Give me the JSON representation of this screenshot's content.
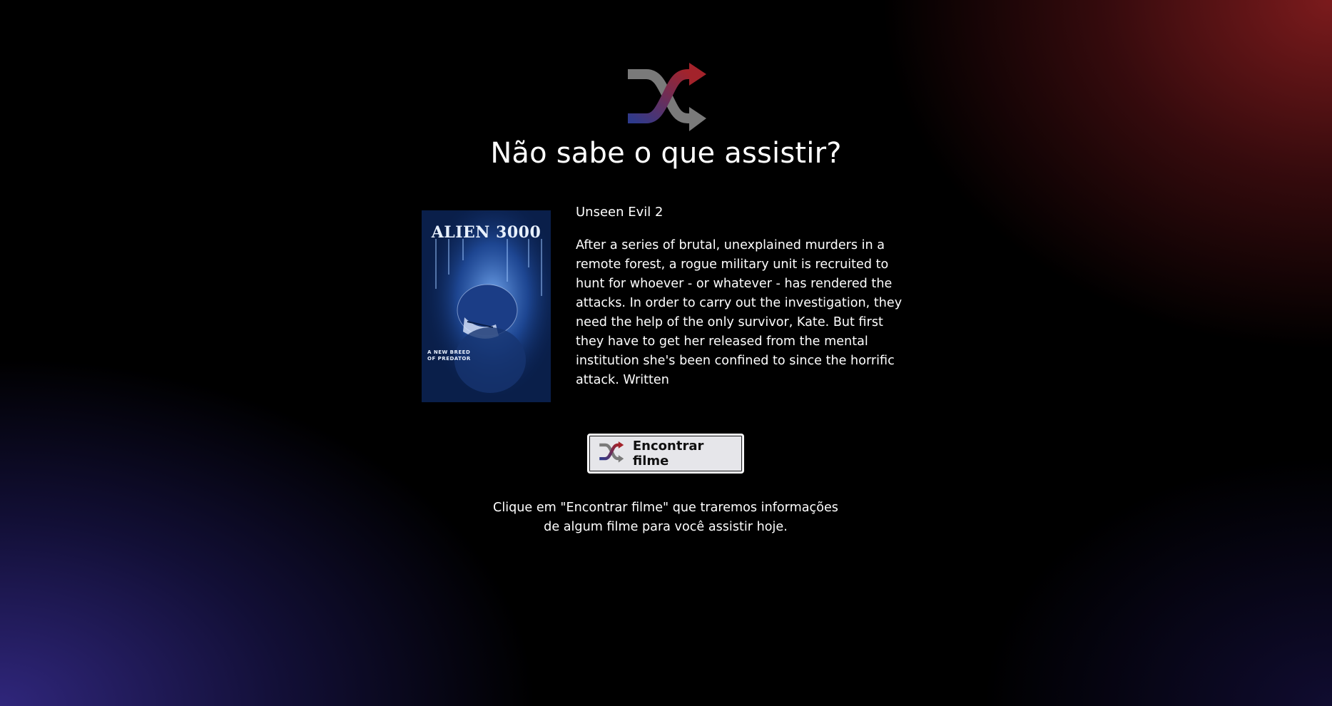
{
  "header": {
    "title": "Não sabe o que assistir?",
    "logo_icon": "shuffle-icon"
  },
  "movie": {
    "poster_title": "ALIEN 3000",
    "poster_tagline_line1": "A NEW BREED",
    "poster_tagline_line2": "OF PREDATOR",
    "title": "Unseen Evil 2",
    "overview": "After a series of brutal, unexplained murders in a remote forest, a rogue military unit is recruited to hunt for whoever - or whatever - has rendered the attacks. In order to carry out the investigation, they need the help of the only survivor, Kate. But first they have to get her released from the mental institution she's been confined to since the horrific attack. Written"
  },
  "action": {
    "button_label": "Encontrar filme",
    "button_icon": "shuffle-icon"
  },
  "hint": {
    "text": "Clique em \"Encontrar filme\" que traremos informações de algum filme para você assistir hoje."
  },
  "colors": {
    "accent_red": "#a3232b",
    "accent_blue": "#2e3a8c",
    "arrow_gray": "#7a7a7a",
    "button_bg": "#e6e6ea"
  }
}
